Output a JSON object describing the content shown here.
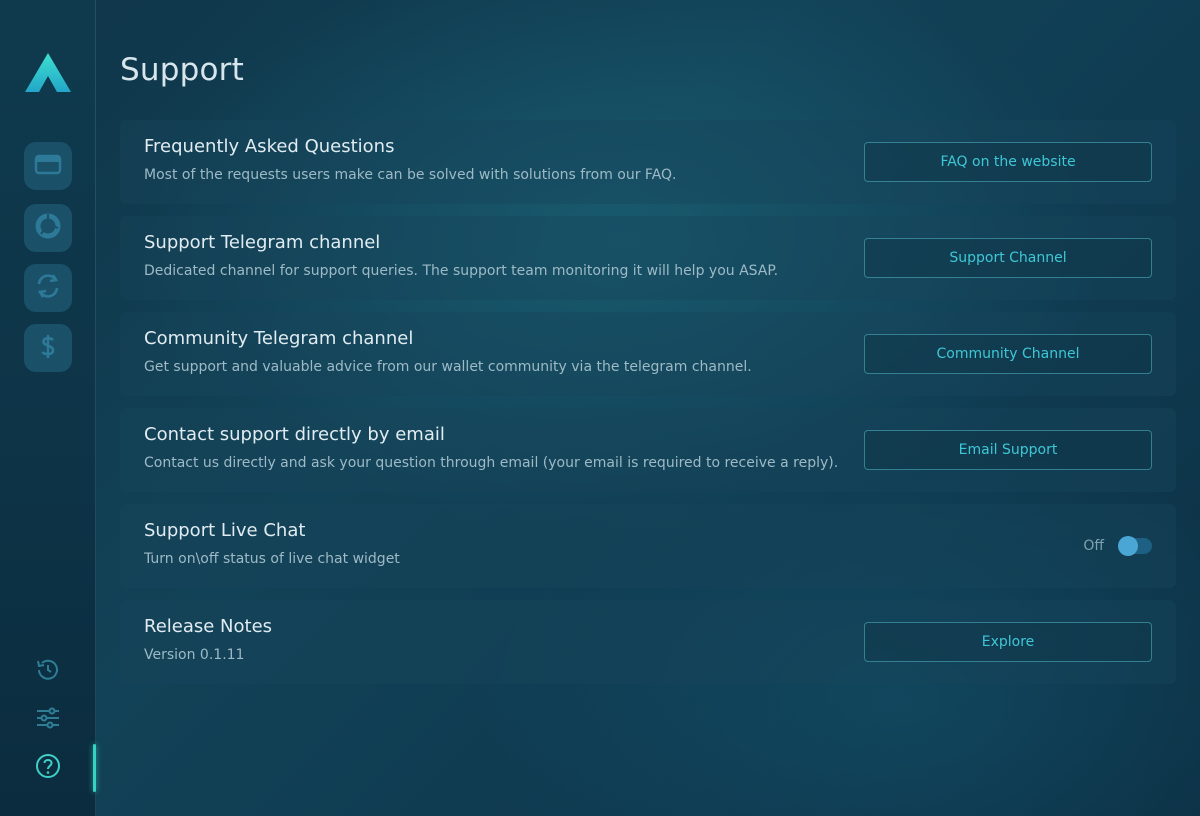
{
  "page": {
    "title": "Support"
  },
  "sidebar": {
    "nav_items": [
      {
        "icon": "wallet-icon",
        "label": "Wallet"
      },
      {
        "icon": "portfolio-chart-icon",
        "label": "Portfolio"
      },
      {
        "icon": "exchange-icon",
        "label": "Exchange"
      },
      {
        "icon": "dollar-icon",
        "label": "Buy"
      }
    ],
    "bottom_items": [
      {
        "icon": "history-icon"
      },
      {
        "icon": "settings-sliders-icon"
      },
      {
        "icon": "help-icon",
        "active": true
      }
    ]
  },
  "sections": {
    "faq": {
      "title": "Frequently Asked Questions",
      "description": "Most of the requests users make can be solved with solutions from our FAQ.",
      "button": "FAQ on the website"
    },
    "support_telegram": {
      "title": "Support Telegram channel",
      "description": "Dedicated channel for support queries. The support team monitoring it will help you ASAP.",
      "button": "Support Channel"
    },
    "community_telegram": {
      "title": "Community Telegram channel",
      "description": "Get support and valuable advice from our wallet community via the telegram channel.",
      "button": "Community Channel"
    },
    "email": {
      "title": "Contact support directly by email",
      "description": "Contact us directly and ask your question through email (your email is required to receive a reply).",
      "button": "Email Support"
    },
    "live_chat": {
      "title": "Support Live Chat",
      "description": "Turn on\\off status of live chat widget",
      "toggle_label": "Off",
      "enabled": false
    },
    "release_notes": {
      "title": "Release Notes",
      "description": "Version 0.1.11",
      "button": "Explore"
    }
  },
  "colors": {
    "accent": "#3ec7d6",
    "active_indicator": "#34d3c2",
    "toggle_knob": "#4aa6d4"
  }
}
